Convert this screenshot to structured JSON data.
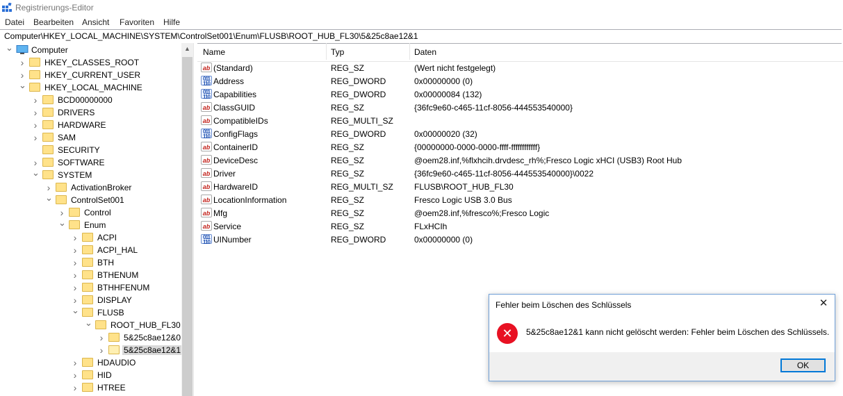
{
  "window": {
    "title": "Registrierungs-Editor"
  },
  "menu": [
    "Datei",
    "Bearbeiten",
    "Ansicht",
    "Favoriten",
    "Hilfe"
  ],
  "address": "Computer\\HKEY_LOCAL_MACHINE\\SYSTEM\\ControlSet001\\Enum\\FLUSB\\ROOT_HUB_FL30\\5&25c8ae12&1",
  "tree": {
    "items": [
      {
        "label": "Computer",
        "depth": 0,
        "expander": "v",
        "icon": "computer"
      },
      {
        "label": "HKEY_CLASSES_ROOT",
        "depth": 1,
        "expander": ">"
      },
      {
        "label": "HKEY_CURRENT_USER",
        "depth": 1,
        "expander": ">"
      },
      {
        "label": "HKEY_LOCAL_MACHINE",
        "depth": 1,
        "expander": "v"
      },
      {
        "label": "BCD00000000",
        "depth": 2,
        "expander": ">"
      },
      {
        "label": "DRIVERS",
        "depth": 2,
        "expander": ">"
      },
      {
        "label": "HARDWARE",
        "depth": 2,
        "expander": ">"
      },
      {
        "label": "SAM",
        "depth": 2,
        "expander": ">"
      },
      {
        "label": "SECURITY",
        "depth": 2,
        "expander": ""
      },
      {
        "label": "SOFTWARE",
        "depth": 2,
        "expander": ">"
      },
      {
        "label": "SYSTEM",
        "depth": 2,
        "expander": "v"
      },
      {
        "label": "ActivationBroker",
        "depth": 3,
        "expander": ">"
      },
      {
        "label": "ControlSet001",
        "depth": 3,
        "expander": "v"
      },
      {
        "label": "Control",
        "depth": 4,
        "expander": ">"
      },
      {
        "label": "Enum",
        "depth": 4,
        "expander": "v"
      },
      {
        "label": "ACPI",
        "depth": 5,
        "expander": ">"
      },
      {
        "label": "ACPI_HAL",
        "depth": 5,
        "expander": ">"
      },
      {
        "label": "BTH",
        "depth": 5,
        "expander": ">"
      },
      {
        "label": "BTHENUM",
        "depth": 5,
        "expander": ">"
      },
      {
        "label": "BTHHFENUM",
        "depth": 5,
        "expander": ">"
      },
      {
        "label": "DISPLAY",
        "depth": 5,
        "expander": ">"
      },
      {
        "label": "FLUSB",
        "depth": 5,
        "expander": "v"
      },
      {
        "label": "ROOT_HUB_FL30",
        "depth": 6,
        "expander": "v"
      },
      {
        "label": "5&25c8ae12&0",
        "depth": 7,
        "expander": ">"
      },
      {
        "label": "5&25c8ae12&1",
        "depth": 7,
        "expander": ">",
        "selected": true
      },
      {
        "label": "HDAUDIO",
        "depth": 5,
        "expander": ">"
      },
      {
        "label": "HID",
        "depth": 5,
        "expander": ">"
      },
      {
        "label": "HTREE",
        "depth": 5,
        "expander": ">"
      }
    ]
  },
  "list": {
    "columns": {
      "name": "Name",
      "type": "Typ",
      "data": "Daten"
    },
    "rows": [
      {
        "icon": "string-value-icon",
        "name": "(Standard)",
        "type": "REG_SZ",
        "data": "(Wert nicht festgelegt)"
      },
      {
        "icon": "binary-value-icon",
        "name": "Address",
        "type": "REG_DWORD",
        "data": "0x00000000 (0)"
      },
      {
        "icon": "binary-value-icon",
        "name": "Capabilities",
        "type": "REG_DWORD",
        "data": "0x00000084 (132)"
      },
      {
        "icon": "string-value-icon",
        "name": "ClassGUID",
        "type": "REG_SZ",
        "data": "{36fc9e60-c465-11cf-8056-444553540000}"
      },
      {
        "icon": "string-value-icon",
        "name": "CompatibleIDs",
        "type": "REG_MULTI_SZ",
        "data": ""
      },
      {
        "icon": "binary-value-icon",
        "name": "ConfigFlags",
        "type": "REG_DWORD",
        "data": "0x00000020 (32)"
      },
      {
        "icon": "string-value-icon",
        "name": "ContainerID",
        "type": "REG_SZ",
        "data": "{00000000-0000-0000-ffff-ffffffffffff}"
      },
      {
        "icon": "string-value-icon",
        "name": "DeviceDesc",
        "type": "REG_SZ",
        "data": "@oem28.inf,%flxhcih.drvdesc_rh%;Fresco Logic xHCI (USB3) Root Hub"
      },
      {
        "icon": "string-value-icon",
        "name": "Driver",
        "type": "REG_SZ",
        "data": "{36fc9e60-c465-11cf-8056-444553540000}\\0022"
      },
      {
        "icon": "string-value-icon",
        "name": "HardwareID",
        "type": "REG_MULTI_SZ",
        "data": "FLUSB\\ROOT_HUB_FL30"
      },
      {
        "icon": "string-value-icon",
        "name": "LocationInformation",
        "type": "REG_SZ",
        "data": "Fresco Logic USB 3.0 Bus"
      },
      {
        "icon": "string-value-icon",
        "name": "Mfg",
        "type": "REG_SZ",
        "data": "@oem28.inf,%fresco%;Fresco Logic"
      },
      {
        "icon": "string-value-icon",
        "name": "Service",
        "type": "REG_SZ",
        "data": "FLxHCIh"
      },
      {
        "icon": "binary-value-icon",
        "name": "UINumber",
        "type": "REG_DWORD",
        "data": "0x00000000 (0)"
      }
    ]
  },
  "dialog": {
    "title": "Fehler beim Löschen des Schlüssels",
    "message": "5&25c8ae12&1 kann nicht gelöscht werden: Fehler beim Löschen des Schlüssels.",
    "ok_label": "OK",
    "close_glyph": "✕",
    "icon": "error-icon",
    "icon_color": "#e81123"
  },
  "colors": {
    "accent": "#0078d7",
    "folder": "#ffe28a",
    "selection": "#d9d9d9"
  }
}
